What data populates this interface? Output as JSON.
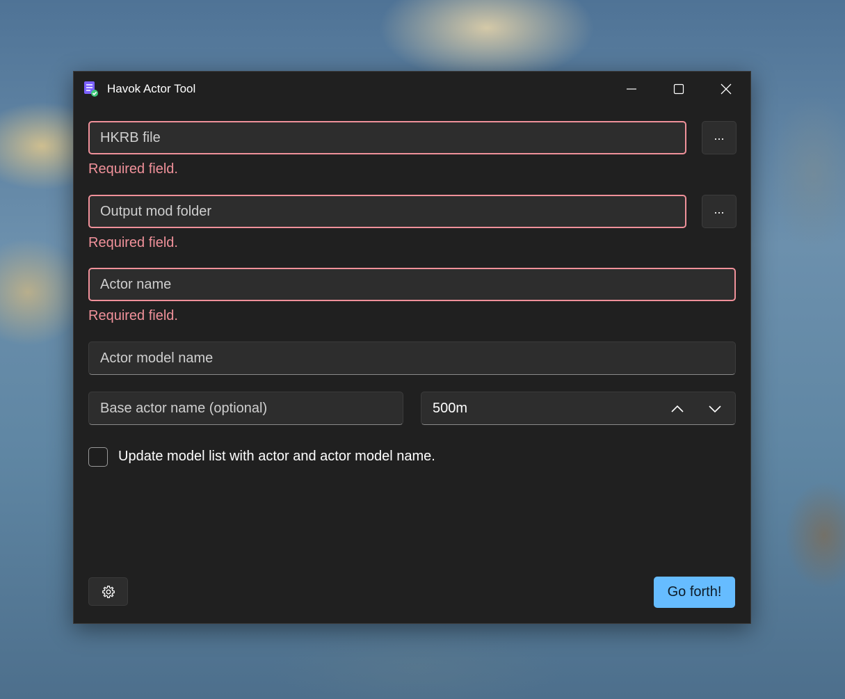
{
  "window": {
    "title": "Havok Actor Tool",
    "icon": "app-document-check-icon",
    "controls": [
      "minimize-icon",
      "maximize-icon",
      "close-icon"
    ]
  },
  "form": {
    "hkrb_file": {
      "placeholder": "HKRB file",
      "value": "",
      "error": "Required field.",
      "browse_label": "..."
    },
    "output_mod_folder": {
      "placeholder": "Output mod folder",
      "value": "",
      "error": "Required field.",
      "browse_label": "..."
    },
    "actor_name": {
      "placeholder": "Actor name",
      "value": "",
      "error": "Required field."
    },
    "actor_model_name": {
      "placeholder": "Actor model name",
      "value": ""
    },
    "base_actor_name": {
      "placeholder": "Base actor name (optional)",
      "value": ""
    },
    "distance": {
      "value": "500m"
    },
    "update_model_list": {
      "label": "Update model list with actor and actor model name.",
      "checked": false
    }
  },
  "footer": {
    "settings_icon": "gear-icon",
    "go_label": "Go forth!"
  },
  "colors": {
    "window_bg": "#202020",
    "field_bg": "#2d2d2d",
    "error": "#f0919a",
    "accent": "#66bcff"
  }
}
